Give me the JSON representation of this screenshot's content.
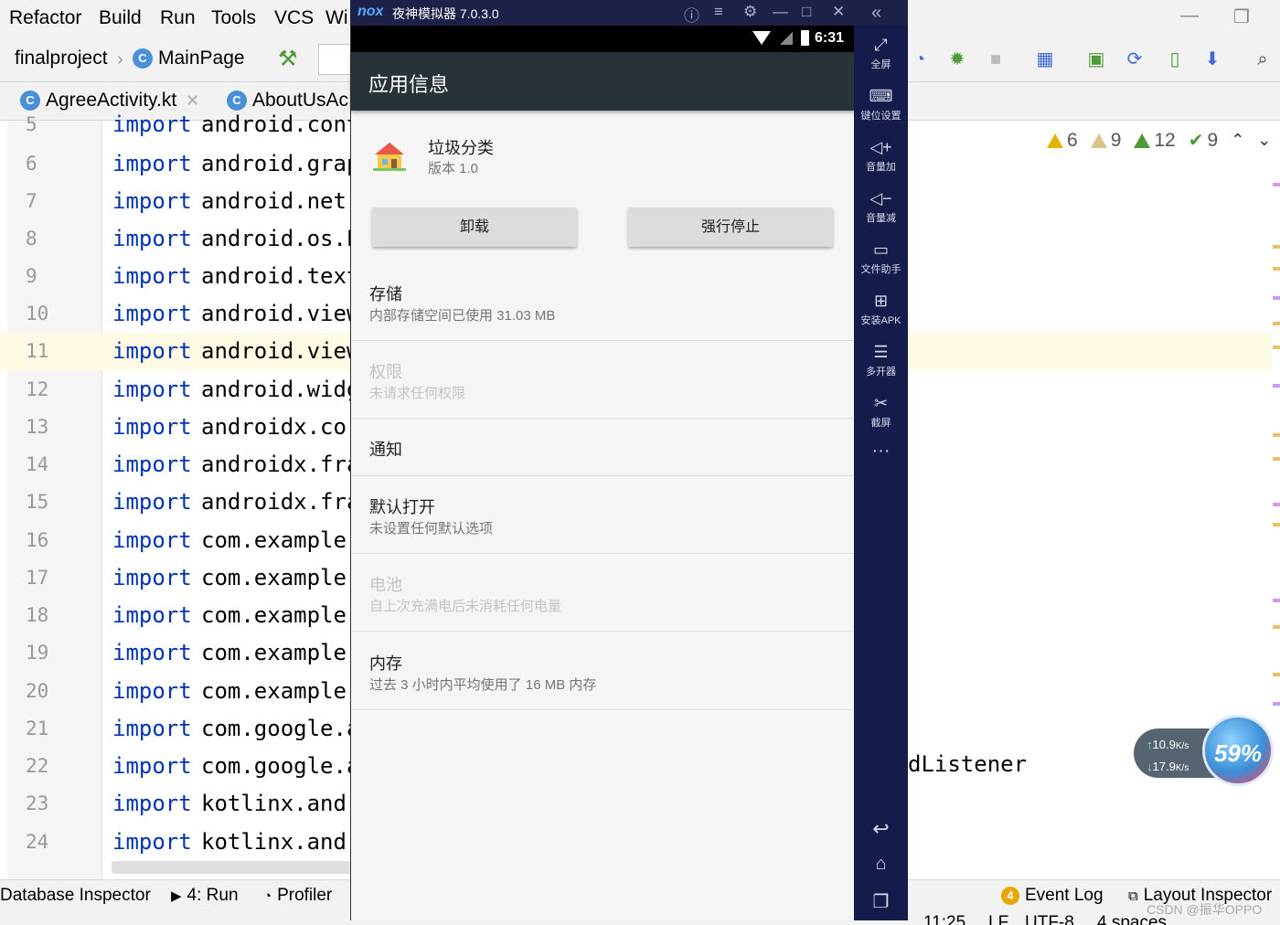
{
  "ide": {
    "menu": [
      "Refactor",
      "Build",
      "Run",
      "Tools",
      "VCS",
      "Wi"
    ],
    "breadcrumb": {
      "project": "finalproject",
      "config": "MainPage"
    },
    "tabs": [
      {
        "label": "AgreeActivity.kt",
        "badge": "C"
      },
      {
        "label": "AboutUsAc",
        "badge": "C"
      }
    ],
    "lines": [
      {
        "n": "5",
        "kw": "import",
        "pkg": "android.cont"
      },
      {
        "n": "6",
        "kw": "import",
        "pkg": "android.grap"
      },
      {
        "n": "7",
        "kw": "import",
        "pkg": "android.net."
      },
      {
        "n": "8",
        "kw": "import",
        "pkg": "android.os.E"
      },
      {
        "n": "9",
        "kw": "import",
        "pkg": "android.text"
      },
      {
        "n": "10",
        "kw": "import",
        "pkg": "android.view"
      },
      {
        "n": "11",
        "kw": "import",
        "pkg": "android.view"
      },
      {
        "n": "12",
        "kw": "import",
        "pkg": "android.widg"
      },
      {
        "n": "13",
        "kw": "import",
        "pkg": "androidx.cor"
      },
      {
        "n": "14",
        "kw": "import",
        "pkg": "androidx.fra"
      },
      {
        "n": "15",
        "kw": "import",
        "pkg": "androidx.fra"
      },
      {
        "n": "16",
        "kw": "import",
        "pkg": "com.example."
      },
      {
        "n": "17",
        "kw": "import",
        "pkg": "com.example."
      },
      {
        "n": "18",
        "kw": "import",
        "pkg": "com.example."
      },
      {
        "n": "19",
        "kw": "import",
        "pkg": "com.example."
      },
      {
        "n": "20",
        "kw": "import",
        "pkg": "com.example."
      },
      {
        "n": "21",
        "kw": "import",
        "pkg": "com.google.a"
      },
      {
        "n": "22",
        "kw": "import",
        "pkg": "com.google.a"
      },
      {
        "n": "23",
        "kw": "import",
        "pkg": "kotlinx.andr"
      },
      {
        "n": "24",
        "kw": "import",
        "pkg": "kotlinx.andr"
      }
    ],
    "code_tail": "dListener",
    "inspections": {
      "errors": "6",
      "warnings": "9",
      "weak": "12",
      "ok": "9"
    },
    "status_tools": {
      "db": "Database Inspector",
      "run": "4: Run",
      "profiler": "Profiler",
      "event_log": "Event Log",
      "event_count": "4",
      "layout": "Layout Inspector"
    },
    "status_info": {
      "pos": "11:25",
      "lf": "LF",
      "enc": "UTF-8",
      "indent": "4 spaces"
    },
    "watermark": "CSDN @振华OPPO",
    "net": {
      "up": "10.9",
      "down": "17.9",
      "unit": "K/s",
      "percent": "59%"
    }
  },
  "emulator": {
    "logo": "nox",
    "title": "夜神模拟器 7.0.3.0",
    "time": "6:31",
    "appbar_title": "应用信息",
    "app_name": "垃圾分类",
    "app_version": "版本 1.0",
    "buttons": {
      "uninstall": "卸载",
      "force_stop": "强行停止"
    },
    "prefs": [
      {
        "title": "存储",
        "sub": "内部存储空间已使用 31.03 MB",
        "disabled": false
      },
      {
        "title": "权限",
        "sub": "未请求任何权限",
        "disabled": true
      },
      {
        "title": "通知",
        "sub": "",
        "disabled": false
      },
      {
        "title": "默认打开",
        "sub": "未设置任何默认选项",
        "disabled": false
      },
      {
        "title": "电池",
        "sub": "自上次充满电后未消耗任何电量",
        "disabled": true
      },
      {
        "title": "内存",
        "sub": "过去 3 小时内平均使用了 16 MB 内存",
        "disabled": false
      }
    ],
    "side": [
      {
        "label": "全屏",
        "icon": "fullscreen-icon"
      },
      {
        "label": "键位设置",
        "icon": "keyboard-icon"
      },
      {
        "label": "音量加",
        "icon": "volume-up-icon"
      },
      {
        "label": "音量减",
        "icon": "volume-down-icon"
      },
      {
        "label": "文件助手",
        "icon": "file-helper-icon"
      },
      {
        "label": "安装APK",
        "icon": "install-apk-icon"
      },
      {
        "label": "多开器",
        "icon": "multi-instance-icon"
      },
      {
        "label": "截屏",
        "icon": "screenshot-icon"
      }
    ],
    "more": "···"
  }
}
